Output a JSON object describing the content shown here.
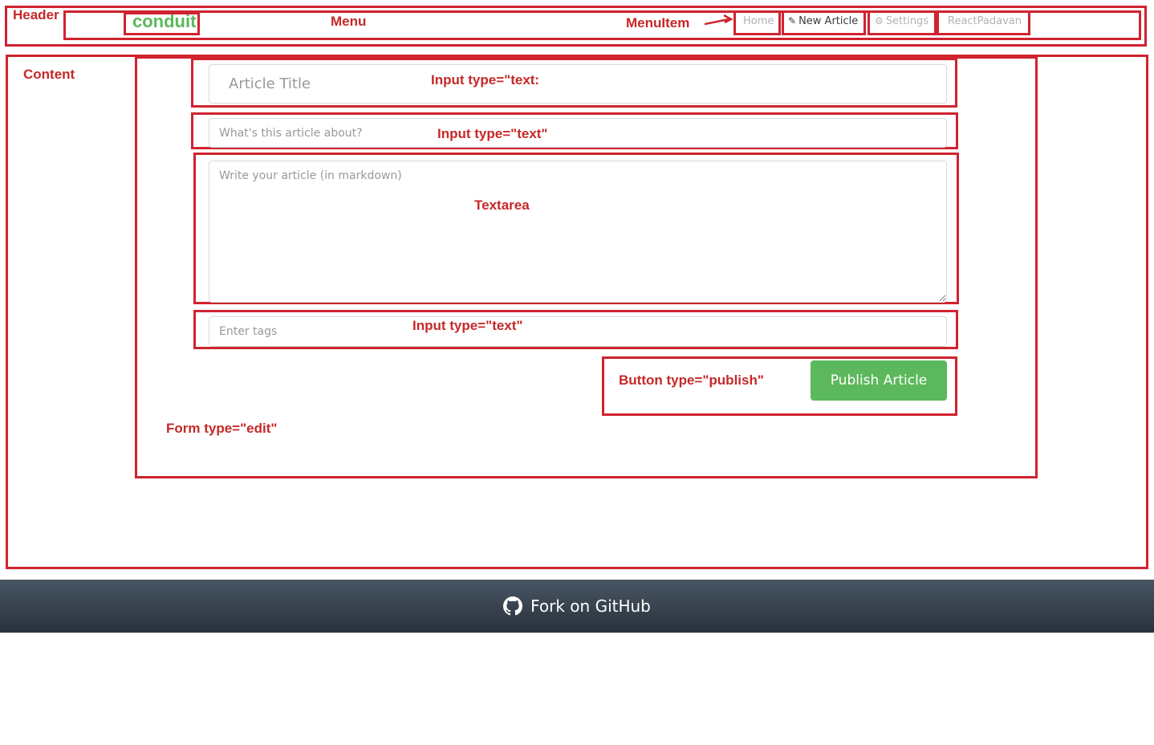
{
  "annotations": {
    "header": "Header",
    "menu": "Menu",
    "menu_item": "MenuItem",
    "content": "Content",
    "input_title": "Input type=\"text:",
    "input_about": "Input type=\"text\"",
    "textarea": "Textarea",
    "input_tags": "Input type=\"text\"",
    "button": "Button type=\"publish\"",
    "form": "Form type=\"edit\""
  },
  "header": {
    "logo": "conduit",
    "nav": [
      {
        "label": "Home",
        "icon": "",
        "active": false
      },
      {
        "label": "New Article",
        "icon": "edit-icon",
        "active": true
      },
      {
        "label": "Settings",
        "icon": "gear-icon",
        "active": false
      },
      {
        "label": "ReactPadavan",
        "icon": "",
        "active": false
      }
    ]
  },
  "editor": {
    "title_placeholder": "Article Title",
    "about_placeholder": "What's this article about?",
    "body_placeholder": "Write your article (in markdown)",
    "tags_placeholder": "Enter tags",
    "publish_label": "Publish Article"
  },
  "footer": {
    "label": "Fork on GitHub",
    "icon": "github-icon"
  },
  "colors": {
    "brand": "#5cb85c",
    "annotation": "#d0232f",
    "nav_inactive": "#b3b3b3",
    "nav_active": "#373a3c",
    "footer_top": "#485563",
    "footer_bottom": "#29323c"
  }
}
